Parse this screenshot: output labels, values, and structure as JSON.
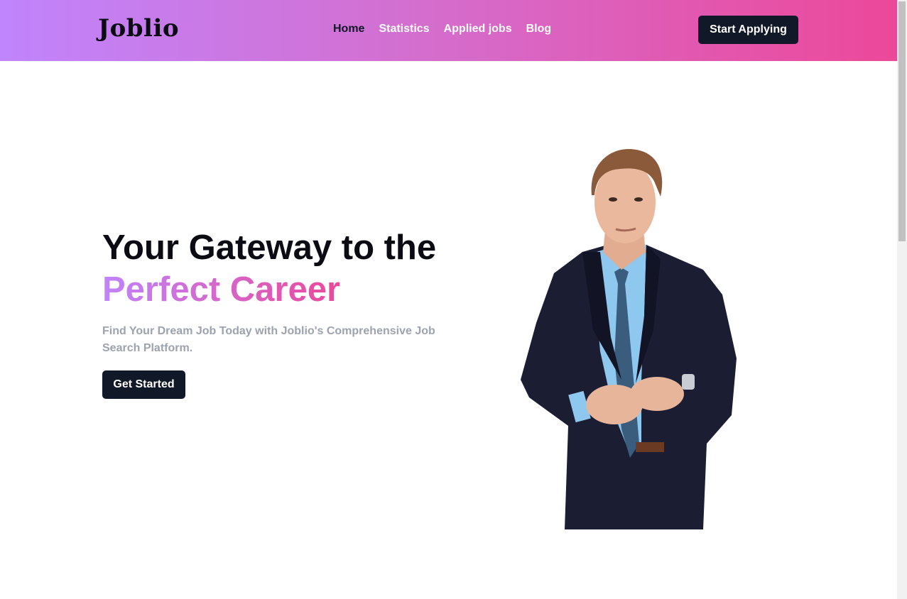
{
  "brand": {
    "name": "Joblio"
  },
  "nav": {
    "links": [
      {
        "label": "Home",
        "active": true
      },
      {
        "label": "Statistics",
        "active": false
      },
      {
        "label": "Applied jobs",
        "active": false
      },
      {
        "label": "Blog",
        "active": false
      }
    ],
    "cta_label": "Start Applying"
  },
  "hero": {
    "title_line1": "Your Gateway to the",
    "title_line2": "Perfect Career",
    "subtitle": "Find Your Dream Job Today with Joblio's Comprehensive Job Search Platform.",
    "button_label": "Get Started"
  },
  "colors": {
    "gradient_start": "#c084fc",
    "gradient_end": "#ec4899",
    "dark": "#111827",
    "muted_text": "#9ca3af",
    "suit": "#1b1d33",
    "shirt": "#8ec8ee"
  }
}
